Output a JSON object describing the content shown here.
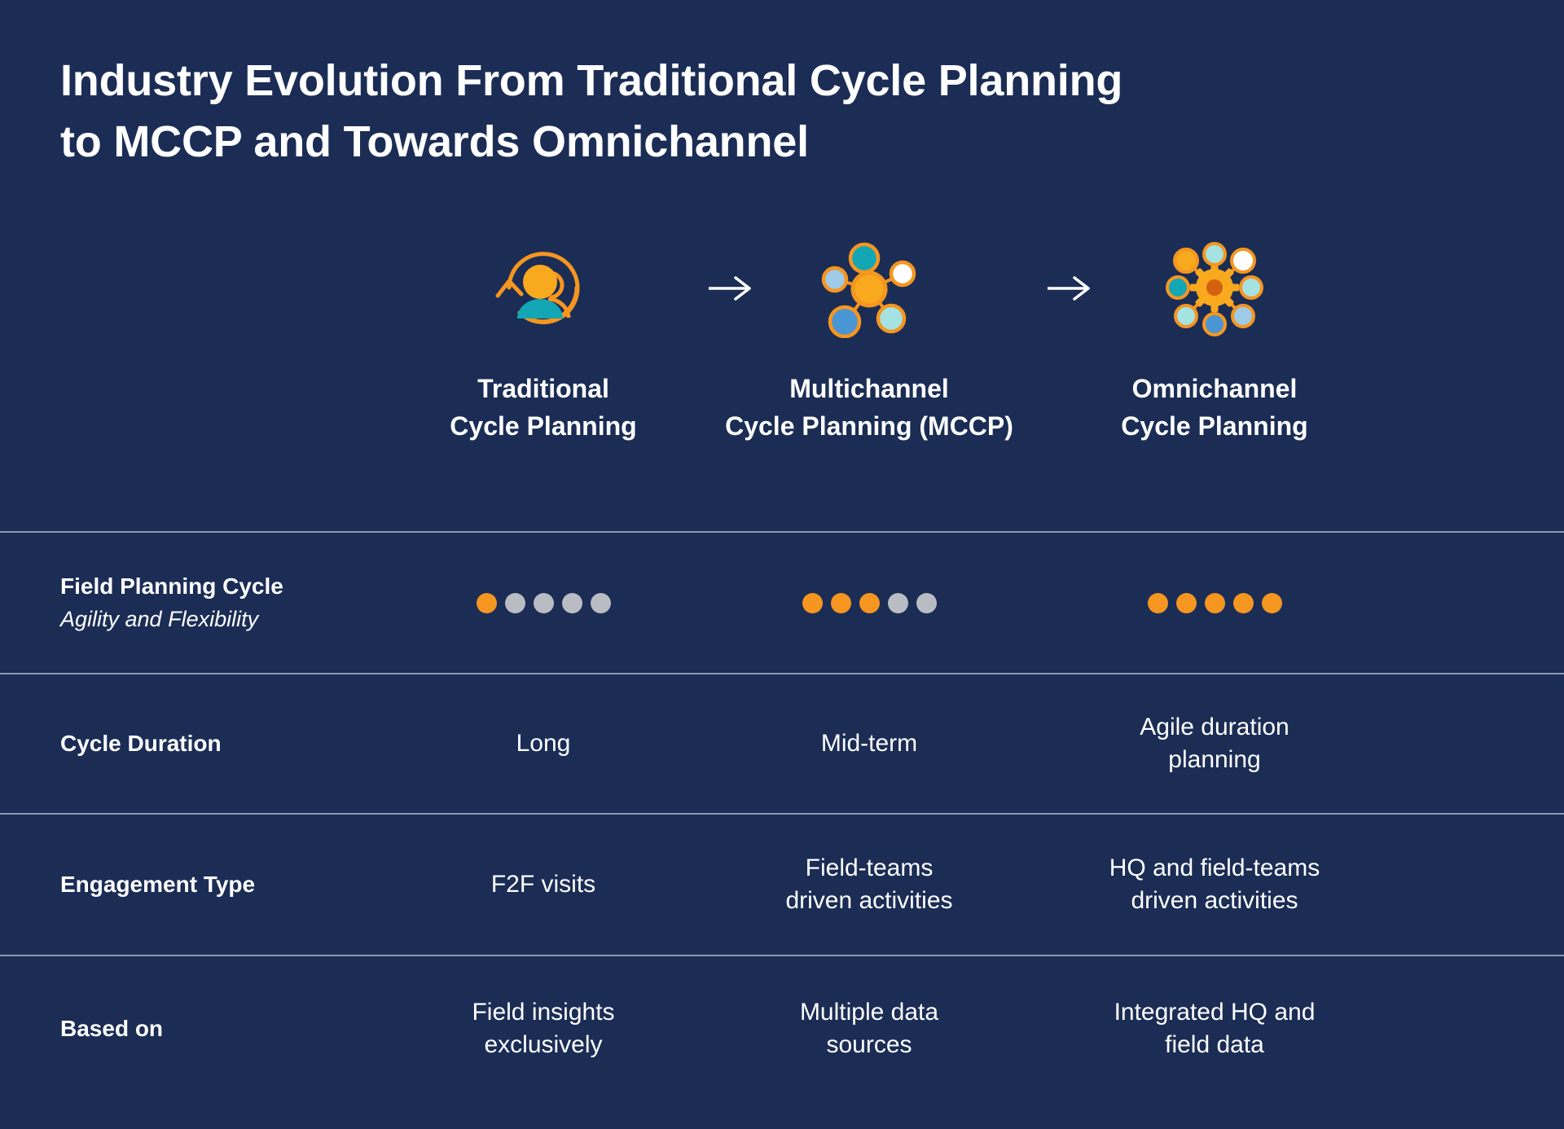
{
  "colors": {
    "background": "#1b2d55",
    "accent_orange": "#f59620",
    "dot_inactive": "#b9bcc2",
    "divider": "#8c98b4",
    "text": "#ffffff",
    "teal": "#13a6b5",
    "light_blue": "#9ecbe8",
    "mid_blue": "#4a95d4",
    "pale_teal": "#a5e3e3",
    "white_node": "#ffffff",
    "deep_orange": "#d4610f"
  },
  "title": "Industry Evolution From Traditional Cycle Planning\nto MCCP and Towards Omnichannel",
  "columns": [
    {
      "label": "Traditional\nCycle Planning",
      "icon": "person-cycle-icon"
    },
    {
      "label": "Multichannel\nCycle Planning (MCCP)",
      "icon": "multichannel-hub-icon"
    },
    {
      "label": "Omnichannel\nCycle Planning",
      "icon": "omnichannel-gear-hub-icon"
    }
  ],
  "arrows": [
    {
      "icon": "arrow-right-icon",
      "label": "→"
    },
    {
      "icon": "arrow-right-icon",
      "label": "→"
    }
  ],
  "rows": [
    {
      "label": "Field Planning Cycle",
      "sublabel": "Agility and Flexibility",
      "type": "rating",
      "max": 5,
      "values": [
        1,
        3,
        5
      ]
    },
    {
      "label": "Cycle Duration",
      "sublabel": "",
      "type": "text",
      "values": [
        "Long",
        "Mid-term",
        "Agile duration\nplanning"
      ]
    },
    {
      "label": "Engagement Type",
      "sublabel": "",
      "type": "text",
      "values": [
        "F2F visits",
        "Field-teams\ndriven activities",
        "HQ and field-teams\ndriven activities"
      ]
    },
    {
      "label": "Based on",
      "sublabel": "",
      "type": "text",
      "values": [
        "Field insights\nexclusively",
        "Multiple data\nsources",
        "Integrated HQ and\nfield data"
      ]
    }
  ]
}
